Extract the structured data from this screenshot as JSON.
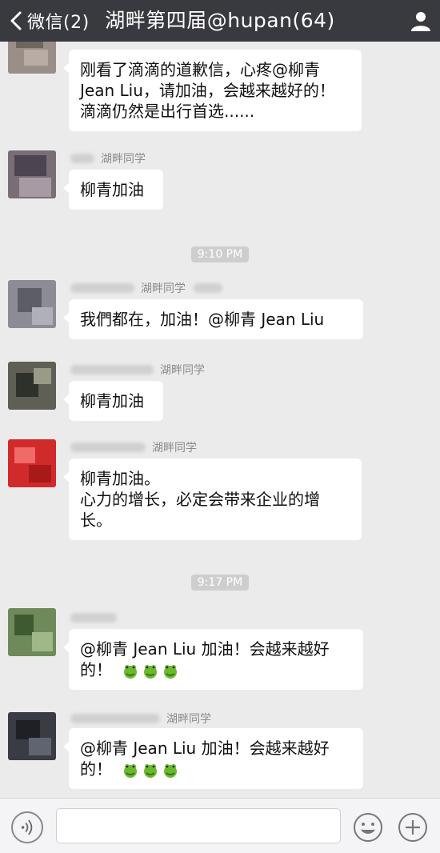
{
  "header": {
    "back_label": "微信(2)",
    "title": "湖畔第四届@hupan(64)"
  },
  "messages": [
    {
      "group_tag": "",
      "text": "刚看了滴滴的道歉信，心疼@柳青 Jean Liu，请加油，会越来越好的！滴滴仍然是出行首选......"
    },
    {
      "group_tag": "湖畔同学",
      "text": "柳青加油"
    },
    {
      "group_tag": "湖畔同学",
      "text": "我們都在，加油！@柳青 Jean Liu"
    },
    {
      "group_tag": "湖畔同学",
      "text": "柳青加油"
    },
    {
      "group_tag": "湖畔同学",
      "text": "柳青加油。\n心力的增长，必定会带来企业的增长。"
    },
    {
      "group_tag": "",
      "text": "@柳青 Jean Liu 加油！会越来越好的！"
    },
    {
      "group_tag": "湖畔同学",
      "text": "@柳青 Jean Liu 加油！会越来越好的！"
    }
  ],
  "timestamps": [
    "9:10 PM",
    "9:17 PM"
  ],
  "icons": {
    "back": "chevron-left-icon",
    "more": "person-icon",
    "voice": "voice-icon",
    "emoji": "smiley-icon",
    "plus": "plus-icon",
    "sticker": "green-frog-emoji"
  },
  "colors": {
    "header_bg": "#393a3f",
    "chat_bg": "#ebebeb",
    "bubble_bg": "#ffffff",
    "timestamp_bg": "#cecece"
  }
}
